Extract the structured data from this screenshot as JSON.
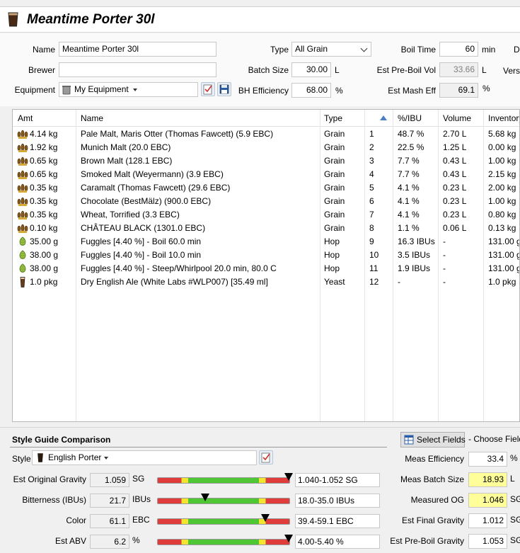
{
  "recipe": {
    "title": "Meantime Porter 30l"
  },
  "form": {
    "name_label": "Name",
    "name_value": "Meantime Porter 30l",
    "brewer_label": "Brewer",
    "brewer_value": "",
    "equipment_label": "Equipment",
    "equipment_value": "My Equipment",
    "type_label": "Type",
    "type_value": "All Grain",
    "batch_label": "Batch Size",
    "batch_value": "30.00",
    "batch_unit": "L",
    "bh_label": "BH Efficiency",
    "bh_value": "68.00",
    "bh_unit": "%",
    "boil_label": "Boil Time",
    "boil_value": "60",
    "boil_unit": "min",
    "preboil_label": "Est Pre-Boil Vol",
    "preboil_value": "33.66",
    "preboil_unit": "L",
    "mash_label": "Est Mash Eff",
    "mash_value": "69.1",
    "mash_unit": "%",
    "cut_d": "D",
    "cut_vers": "Vers"
  },
  "table": {
    "headers": [
      "Amt",
      "Name",
      "Type",
      "",
      "%/IBU",
      "Volume",
      "Inventory"
    ],
    "rows": [
      {
        "icon": "grain",
        "amt": "4.14 kg",
        "name": "Pale Malt, Maris Otter (Thomas Fawcett) (5.9 EBC)",
        "type": "Grain",
        "num": "1",
        "pct": "48.7 %",
        "vol": "2.70 L",
        "inv": "5.68 kg"
      },
      {
        "icon": "grain",
        "amt": "1.92 kg",
        "name": "Munich Malt (20.0 EBC)",
        "type": "Grain",
        "num": "2",
        "pct": "22.5 %",
        "vol": "1.25 L",
        "inv": "0.00 kg"
      },
      {
        "icon": "grain",
        "amt": "0.65 kg",
        "name": "Brown Malt (128.1 EBC)",
        "type": "Grain",
        "num": "3",
        "pct": "7.7 %",
        "vol": "0.43 L",
        "inv": "1.00 kg"
      },
      {
        "icon": "grain",
        "amt": "0.65 kg",
        "name": "Smoked Malt (Weyermann) (3.9 EBC)",
        "type": "Grain",
        "num": "4",
        "pct": "7.7 %",
        "vol": "0.43 L",
        "inv": "2.15 kg"
      },
      {
        "icon": "grain",
        "amt": "0.35 kg",
        "name": "Caramalt (Thomas Fawcett) (29.6 EBC)",
        "type": "Grain",
        "num": "5",
        "pct": "4.1 %",
        "vol": "0.23 L",
        "inv": "2.00 kg"
      },
      {
        "icon": "grain",
        "amt": "0.35 kg",
        "name": "Chocolate (BestMälz) (900.0 EBC)",
        "type": "Grain",
        "num": "6",
        "pct": "4.1 %",
        "vol": "0.23 L",
        "inv": "1.00 kg"
      },
      {
        "icon": "grain",
        "amt": "0.35 kg",
        "name": "Wheat, Torrified (3.3 EBC)",
        "type": "Grain",
        "num": "7",
        "pct": "4.1 %",
        "vol": "0.23 L",
        "inv": "0.80 kg"
      },
      {
        "icon": "grain",
        "amt": "0.10 kg",
        "name": "CHÂTEAU BLACK (1301.0 EBC)",
        "type": "Grain",
        "num": "8",
        "pct": "1.1 %",
        "vol": "0.06 L",
        "inv": "0.13 kg"
      },
      {
        "icon": "hop",
        "amt": "35.00 g",
        "name": "Fuggles [4.40 %] - Boil 60.0 min",
        "type": "Hop",
        "num": "9",
        "pct": "16.3 IBUs",
        "vol": "-",
        "inv": "131.00 g"
      },
      {
        "icon": "hop",
        "amt": "38.00 g",
        "name": "Fuggles [4.40 %] - Boil 10.0 min",
        "type": "Hop",
        "num": "10",
        "pct": "3.5 IBUs",
        "vol": "-",
        "inv": "131.00 g"
      },
      {
        "icon": "hop",
        "amt": "38.00 g",
        "name": "Fuggles [4.40 %] - Steep/Whirlpool  20.0 min, 80.0 C",
        "type": "Hop",
        "num": "11",
        "pct": "1.9 IBUs",
        "vol": "-",
        "inv": "131.00 g"
      },
      {
        "icon": "yeast",
        "amt": "1.0 pkg",
        "name": "Dry English Ale (White Labs #WLP007) [35.49 ml]",
        "type": "Yeast",
        "num": "12",
        "pct": "-",
        "vol": "-",
        "inv": "1.0 pkg"
      }
    ]
  },
  "style": {
    "section_title": "Style Guide Comparison",
    "style_label": "Style",
    "style_value": "English Porter",
    "select_fields_label": "Select Fields",
    "choose_fields_label": "- Choose Field",
    "stats": [
      {
        "label": "Est Original Gravity",
        "value": "1.059",
        "unit": "SG",
        "range": "1.040-1.052 SG",
        "marker": 1.0
      },
      {
        "label": "Bitterness (IBUs)",
        "value": "21.7",
        "unit": "IBUs",
        "range": "18.0-35.0 IBUs",
        "marker": 0.36
      },
      {
        "label": "Color",
        "value": "61.1",
        "unit": "EBC",
        "range": "39.4-59.1 EBC",
        "marker": 0.82
      },
      {
        "label": "Est ABV",
        "value": "6.2",
        "unit": "%",
        "range": "4.00-5.40 %",
        "marker": 1.0
      }
    ],
    "measured": [
      {
        "label": "Meas Efficiency",
        "value": "33.4",
        "unit": "%",
        "highlight": false
      },
      {
        "label": "Meas Batch Size",
        "value": "18.93",
        "unit": "L",
        "highlight": true
      },
      {
        "label": "Measured OG",
        "value": "1.046",
        "unit": "SG",
        "highlight": true
      },
      {
        "label": "Est Final Gravity",
        "value": "1.012",
        "unit": "SG",
        "highlight": false
      },
      {
        "label": "Est Pre-Boil Gravity",
        "value": "1.053",
        "unit": "SG",
        "highlight": false
      }
    ]
  },
  "colors": {
    "gauge_red": "#e03c3c",
    "gauge_yellow": "#f2e530",
    "gauge_green": "#4fc735",
    "highlight": "#ffff99"
  }
}
